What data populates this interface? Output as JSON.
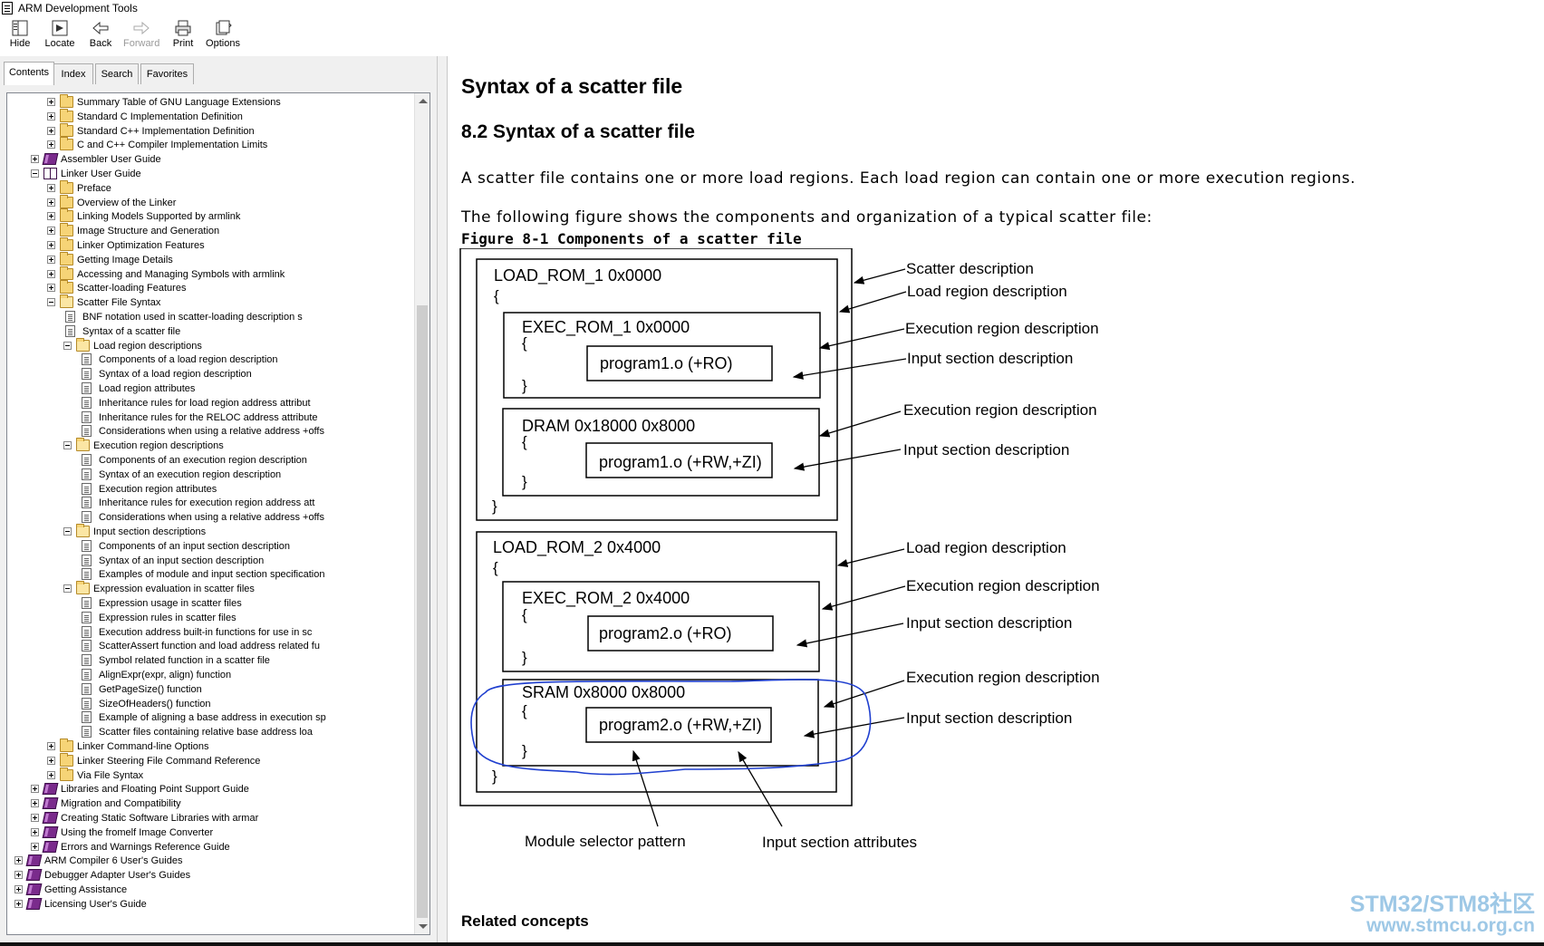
{
  "window": {
    "title": "ARM Development Tools"
  },
  "toolbar": {
    "buttons": [
      {
        "label": "Hide",
        "icon": "hide-icon"
      },
      {
        "label": "Locate",
        "icon": "locate-icon"
      },
      {
        "label": "Back",
        "icon": "back-arrow-icon"
      },
      {
        "label": "Forward",
        "icon": "forward-arrow-icon",
        "disabled": true
      },
      {
        "label": "Print",
        "icon": "printer-icon"
      },
      {
        "label": "Options",
        "icon": "options-icon"
      }
    ]
  },
  "nav_tabs": [
    "Contents",
    "Index",
    "Search",
    "Favorites"
  ],
  "tree": [
    {
      "label": "Summary Table of GNU Language Extensions",
      "level": 2,
      "type": "folder",
      "expander": "plus"
    },
    {
      "label": "Standard C Implementation Definition",
      "level": 2,
      "type": "folder",
      "expander": "plus"
    },
    {
      "label": "Standard C++ Implementation Definition",
      "level": 2,
      "type": "folder",
      "expander": "plus"
    },
    {
      "label": "C and C++ Compiler Implementation Limits",
      "level": 2,
      "type": "folder",
      "expander": "plus"
    },
    {
      "label": "Assembler User Guide",
      "level": 1,
      "type": "book",
      "expander": "plus"
    },
    {
      "label": "Linker User Guide",
      "level": 1,
      "type": "book-open",
      "expander": "minus"
    },
    {
      "label": "Preface",
      "level": 2,
      "type": "folder",
      "expander": "plus"
    },
    {
      "label": "Overview of the Linker",
      "level": 2,
      "type": "folder",
      "expander": "plus"
    },
    {
      "label": "Linking Models Supported by armlink",
      "level": 2,
      "type": "folder",
      "expander": "plus"
    },
    {
      "label": "Image Structure and Generation",
      "level": 2,
      "type": "folder",
      "expander": "plus"
    },
    {
      "label": "Linker Optimization Features",
      "level": 2,
      "type": "folder",
      "expander": "plus"
    },
    {
      "label": "Getting Image Details",
      "level": 2,
      "type": "folder",
      "expander": "plus"
    },
    {
      "label": "Accessing and Managing Symbols with armlink",
      "level": 2,
      "type": "folder",
      "expander": "plus"
    },
    {
      "label": "Scatter-loading Features",
      "level": 2,
      "type": "folder",
      "expander": "plus"
    },
    {
      "label": "Scatter File Syntax",
      "level": 2,
      "type": "folder-open",
      "expander": "minus"
    },
    {
      "label": "BNF notation used in scatter-loading description s",
      "level": 3,
      "type": "page"
    },
    {
      "label": "Syntax of a scatter file",
      "level": 3,
      "type": "page"
    },
    {
      "label": "Load region descriptions",
      "level": 3,
      "type": "folder-open",
      "expander": "minus"
    },
    {
      "label": "Components of a load region description",
      "level": 4,
      "type": "page"
    },
    {
      "label": "Syntax of a load region description",
      "level": 4,
      "type": "page"
    },
    {
      "label": "Load region attributes",
      "level": 4,
      "type": "page"
    },
    {
      "label": "Inheritance rules for load region address attribut",
      "level": 4,
      "type": "page"
    },
    {
      "label": "Inheritance rules for the RELOC address attribute",
      "level": 4,
      "type": "page"
    },
    {
      "label": "Considerations when using a relative address +offs",
      "level": 4,
      "type": "page"
    },
    {
      "label": "Execution region descriptions",
      "level": 3,
      "type": "folder-open",
      "expander": "minus"
    },
    {
      "label": "Components of an execution region description",
      "level": 4,
      "type": "page"
    },
    {
      "label": "Syntax of an execution region description",
      "level": 4,
      "type": "page"
    },
    {
      "label": "Execution region attributes",
      "level": 4,
      "type": "page"
    },
    {
      "label": "Inheritance rules for execution region address att",
      "level": 4,
      "type": "page"
    },
    {
      "label": "Considerations when using a relative address +offs",
      "level": 4,
      "type": "page"
    },
    {
      "label": "Input section descriptions",
      "level": 3,
      "type": "folder-open",
      "expander": "minus"
    },
    {
      "label": "Components of an input section description",
      "level": 4,
      "type": "page"
    },
    {
      "label": "Syntax of an input section description",
      "level": 4,
      "type": "page"
    },
    {
      "label": "Examples of module and input section specification",
      "level": 4,
      "type": "page"
    },
    {
      "label": "Expression evaluation in scatter files",
      "level": 3,
      "type": "folder-open",
      "expander": "minus"
    },
    {
      "label": "Expression usage in scatter files",
      "level": 4,
      "type": "page"
    },
    {
      "label": "Expression rules in scatter files",
      "level": 4,
      "type": "page"
    },
    {
      "label": "Execution address built-in functions for use in sc",
      "level": 4,
      "type": "page"
    },
    {
      "label": "ScatterAssert function and load address related fu",
      "level": 4,
      "type": "page"
    },
    {
      "label": "Symbol related function in a scatter file",
      "level": 4,
      "type": "page"
    },
    {
      "label": "AlignExpr(expr, align) function",
      "level": 4,
      "type": "page"
    },
    {
      "label": "GetPageSize() function",
      "level": 4,
      "type": "page"
    },
    {
      "label": "SizeOfHeaders() function",
      "level": 4,
      "type": "page"
    },
    {
      "label": "Example of aligning a base address in execution sp",
      "level": 4,
      "type": "page"
    },
    {
      "label": "Scatter files containing relative base address loa",
      "level": 4,
      "type": "page"
    },
    {
      "label": "Linker Command-line Options",
      "level": 2,
      "type": "folder",
      "expander": "plus"
    },
    {
      "label": "Linker Steering File Command Reference",
      "level": 2,
      "type": "folder",
      "expander": "plus"
    },
    {
      "label": "Via File Syntax",
      "level": 2,
      "type": "folder",
      "expander": "plus"
    },
    {
      "label": "Libraries and Floating Point Support Guide",
      "level": 1,
      "type": "book",
      "expander": "plus"
    },
    {
      "label": "Migration and Compatibility",
      "level": 1,
      "type": "book",
      "expander": "plus"
    },
    {
      "label": "Creating Static Software Libraries with armar",
      "level": 1,
      "type": "book",
      "expander": "plus"
    },
    {
      "label": "Using the fromelf Image Converter",
      "level": 1,
      "type": "book",
      "expander": "plus"
    },
    {
      "label": "Errors and Warnings Reference Guide",
      "level": 1,
      "type": "book",
      "expander": "plus"
    },
    {
      "label": "ARM Compiler 6 User's Guides",
      "level": 0,
      "type": "book",
      "expander": "plus"
    },
    {
      "label": "Debugger Adapter User's Guides",
      "level": 0,
      "type": "book",
      "expander": "plus"
    },
    {
      "label": "Getting Assistance",
      "level": 0,
      "type": "book",
      "expander": "plus"
    },
    {
      "label": "Licensing User's Guide",
      "level": 0,
      "type": "book",
      "expander": "plus"
    }
  ],
  "content": {
    "title": "Syntax of a scatter file",
    "heading": "8.2 Syntax of a scatter file",
    "para1": "A scatter file contains one or more load regions. Each load region can contain one or more execution regions.",
    "para2": "The following figure shows the components and organization of a typical scatter file:",
    "figure_caption": "Figure 8-1 Components of a scatter file",
    "related": "Related concepts",
    "diagram": {
      "load1": "LOAD_ROM_1 0x0000",
      "exec1": "EXEC_ROM_1 0x0000",
      "in1": "program1.o (+RO)",
      "dram": "DRAM 0x18000 0x8000",
      "in2": "program1.o (+RW,+ZI)",
      "load2": "LOAD_ROM_2 0x4000",
      "exec2": "EXEC_ROM_2 0x4000",
      "in3": "program2.o (+RO)",
      "sram": "SRAM 0x8000 0x8000",
      "in4": "program2.o (+RW,+ZI)",
      "open_brace": "{",
      "close_brace": "}",
      "labels": {
        "scatter": "Scatter description",
        "load_a": "Load region description",
        "exec_a": "Execution region description",
        "input_a": "Input section description",
        "exec_b": "Execution region description",
        "input_b": "Input section description",
        "load_b": "Load region description",
        "exec_c": "Execution region description",
        "input_c": "Input section description",
        "exec_d": "Execution region description",
        "input_d": "Input section description",
        "module_selector": "Module selector pattern",
        "input_attrs": "Input section attributes"
      }
    }
  },
  "watermark": {
    "line1": "STM32/STM8社区",
    "line2": "www.stmcu.org.cn"
  }
}
